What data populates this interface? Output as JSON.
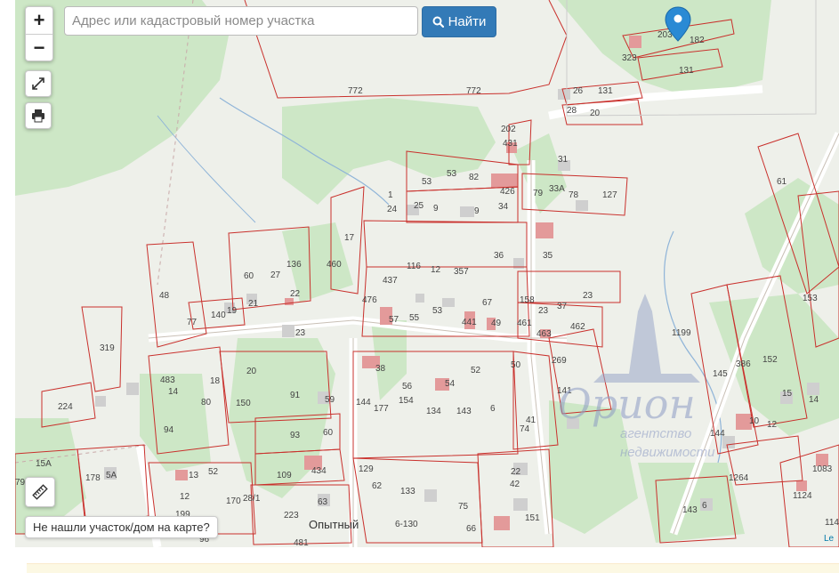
{
  "search": {
    "placeholder": "Адрес или кадастровый номер участка",
    "button_label": "Найти"
  },
  "controls": {
    "zoom_in": "+",
    "zoom_out": "−"
  },
  "not_found_label": "Не нашли участок/дом на карте?",
  "attribution": "Le",
  "watermark": {
    "brand": "Орион",
    "line1": "агентство",
    "line2": "недвижимости"
  },
  "place_name": "Опытный",
  "colors": {
    "parcel_stroke": "#c9302c",
    "vegetation": "#cde7c6",
    "building": "#e39a9a",
    "search_button": "#337ab7",
    "marker": "#2a8ad4"
  },
  "parcels": [
    "772",
    "772",
    "203",
    "182",
    "323",
    "131",
    "131",
    "26",
    "28",
    "20",
    "202",
    "431",
    "31",
    "53",
    "53",
    "82",
    "426",
    "79",
    "33А",
    "78",
    "127",
    "1",
    "24",
    "25",
    "9",
    "9",
    "34",
    "17",
    "460",
    "136",
    "27",
    "60",
    "22",
    "476",
    "437",
    "116",
    "12",
    "357",
    "36",
    "35",
    "67",
    "48",
    "77",
    "140",
    "19",
    "21",
    "57",
    "55",
    "53",
    "441",
    "49",
    "158",
    "23",
    "23",
    "37",
    "461",
    "463",
    "462",
    "23",
    "319",
    "483",
    "18",
    "20",
    "14",
    "80",
    "150",
    "91",
    "59",
    "93",
    "60",
    "38",
    "52",
    "50",
    "56",
    "54",
    "144",
    "177",
    "154",
    "134",
    "143",
    "6",
    "41",
    "74",
    "269",
    "141",
    "224",
    "94",
    "15А",
    "178",
    "5А",
    "13",
    "52",
    "109",
    "434",
    "129",
    "62",
    "133",
    "22",
    "42",
    "12",
    "170",
    "28/1",
    "223",
    "63",
    "75",
    "6-130",
    "66",
    "151",
    "199",
    "96",
    "481",
    "79",
    "61",
    "153",
    "1199",
    "386",
    "152",
    "145",
    "15",
    "14",
    "144",
    "10",
    "12",
    "1264",
    "143",
    "6",
    "1083",
    "1124",
    "114"
  ]
}
